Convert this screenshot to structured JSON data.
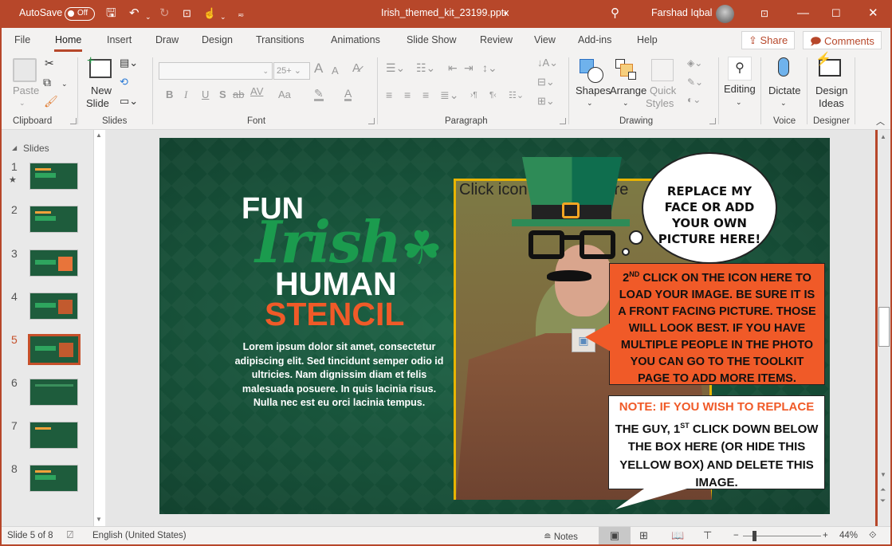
{
  "titlebar": {
    "autosave_label": "AutoSave",
    "autosave_state": "Off",
    "filename": "Irish_themed_kit_23199.pptx",
    "filename_dropdown": "▾",
    "user_name": "Farshad Iqbal"
  },
  "tabs": [
    "File",
    "Home",
    "Insert",
    "Draw",
    "Design",
    "Transitions",
    "Animations",
    "Slide Show",
    "Review",
    "View",
    "Add-ins",
    "Help"
  ],
  "active_tab": "Home",
  "share_label": "Share",
  "comments_label": "Comments",
  "ribbon": {
    "clipboard": {
      "paste_label": "Paste",
      "group_label": "Clipboard"
    },
    "slides": {
      "new_slide_line1": "New",
      "new_slide_line2": "Slide",
      "group_label": "Slides"
    },
    "font": {
      "font_name_value": "",
      "font_size_value": "25+",
      "group_label": "Font",
      "bold": "B",
      "italic": "I",
      "underline": "U",
      "shadow": "S",
      "strike": "ab",
      "spacing": "AV",
      "case": "Aa",
      "grow": "A",
      "shrink": "A"
    },
    "paragraph": {
      "group_label": "Paragraph"
    },
    "drawing": {
      "shapes_label": "Shapes",
      "arrange_label": "Arrange",
      "quick_styles_line1": "Quick",
      "quick_styles_line2": "Styles",
      "group_label": "Drawing"
    },
    "editing": {
      "label": "Editing"
    },
    "voice": {
      "dictate_label": "Dictate",
      "group_label": "Voice"
    },
    "designer": {
      "line1": "Design",
      "line2": "Ideas",
      "group_label": "Designer"
    }
  },
  "slides_pane": {
    "header": "Slides",
    "slides": [
      {
        "number": "1",
        "starred": true
      },
      {
        "number": "2"
      },
      {
        "number": "3"
      },
      {
        "number": "4"
      },
      {
        "number": "5",
        "selected": true
      },
      {
        "number": "6"
      },
      {
        "number": "7"
      },
      {
        "number": "8"
      }
    ]
  },
  "slide": {
    "title_fun": "FUN",
    "title_irish": "Irish",
    "title_human": "HUMAN",
    "title_stencil": "STENCIL",
    "body_text": "Lorem ipsum dolor sit amet, consectetur adipiscing elit. Sed tincidunt semper odio id ultricies. Nam dignissim diam et felis malesuada posuere. In quis lacinia risus. Nulla nec est eu orci lacinia tempus.",
    "placeholder_text": "Click icon to add picture",
    "thought_bubble": "REPLACE MY FACE OR ADD YOUR OWN PICTURE HERE!",
    "orange_callout_prefix": "2",
    "orange_callout_sup": "ND",
    "orange_callout": " CLICK ON THE ICON HERE TO LOAD YOUR IMAGE. BE SURE IT IS A FRONT FACING PICTURE. THOSE WILL LOOK BEST. IF YOU HAVE MULTIPLE PEOPLE IN THE PHOTO YOU CAN GO TO THE TOOLKIT PAGE TO ADD MORE ITEMS.",
    "note_heading": "NOTE: IF YOU WISH TO REPLACE",
    "note_prefix": "THE GUY, 1",
    "note_sup": "ST",
    "note_rest": " CLICK DOWN BELOW THE BOX HERE (OR HIDE THIS YELLOW BOX) AND DELETE THIS IMAGE.",
    "colors": {
      "green": "#1b9b4e",
      "orange": "#f05a28",
      "yellow": "#e8b400"
    }
  },
  "statusbar": {
    "slide_info": "Slide 5 of 8",
    "language": "English (United States)",
    "notes_label": "Notes",
    "zoom_level": "44%",
    "zoom_fraction": 0.44
  },
  "colors": {
    "accent": "#b7472a"
  }
}
